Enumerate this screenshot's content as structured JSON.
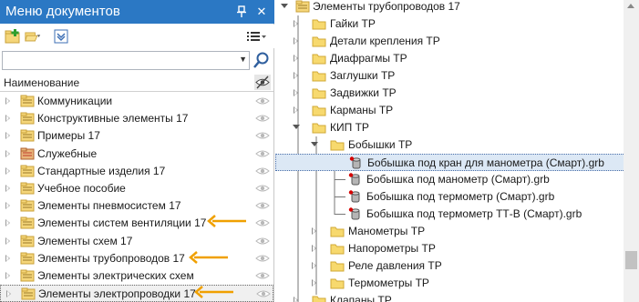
{
  "panel": {
    "title": "Меню документов",
    "pin_glyph": "⊥",
    "close_glyph": "✕",
    "search_placeholder": "",
    "column_header": "Наименование",
    "items": [
      {
        "label": "Коммуникации",
        "icon": "folder-icon"
      },
      {
        "label": "Конструктивные элементы 17",
        "icon": "folder-icon"
      },
      {
        "label": "Примеры 17",
        "icon": "folder-icon"
      },
      {
        "label": "Служебные",
        "icon": "folder-red-icon"
      },
      {
        "label": "Стандартные изделия 17",
        "icon": "folder-icon"
      },
      {
        "label": "Учебное пособие",
        "icon": "folder-icon"
      },
      {
        "label": "Элементы пневмосистем 17",
        "icon": "folder-icon"
      },
      {
        "label": "Элементы систем вентиляции 17",
        "icon": "folder-icon"
      },
      {
        "label": "Элементы схем 17",
        "icon": "folder-icon"
      },
      {
        "label": "Элементы трубопроводов 17",
        "icon": "folder-icon"
      },
      {
        "label": "Элементы электрических схем",
        "icon": "folder-icon"
      },
      {
        "label": "Элементы электропроводки 17",
        "icon": "folder-icon"
      }
    ],
    "highlighted_items": [
      7,
      9,
      11
    ],
    "selected_item": 11
  },
  "tree": {
    "root": "Элементы трубопроводов 17",
    "nodes": [
      {
        "label": "Гайки ТР",
        "level": 1,
        "expand": "collapsed",
        "icon": "folder-icon"
      },
      {
        "label": "Детали крепления ТР",
        "level": 1,
        "expand": "collapsed",
        "icon": "folder-icon"
      },
      {
        "label": "Диафрагмы ТР",
        "level": 1,
        "expand": "collapsed",
        "icon": "folder-icon"
      },
      {
        "label": "Заглушки ТР",
        "level": 1,
        "expand": "collapsed",
        "icon": "folder-icon"
      },
      {
        "label": "Задвижки ТР",
        "level": 1,
        "expand": "collapsed",
        "icon": "folder-icon"
      },
      {
        "label": "Карманы ТР",
        "level": 1,
        "expand": "collapsed",
        "icon": "folder-icon"
      },
      {
        "label": "КИП ТР",
        "level": 1,
        "expand": "expanded",
        "icon": "folder-open-icon"
      },
      {
        "label": "Бобышки ТР",
        "level": 2,
        "expand": "expanded",
        "icon": "folder-open-icon"
      },
      {
        "label": "Бобышка под кран для манометра (Смарт).grb",
        "level": 3,
        "expand": "none",
        "icon": "part-file-icon"
      },
      {
        "label": "Бобышка под манометр (Смарт).grb",
        "level": 3,
        "expand": "none",
        "icon": "part-file-icon"
      },
      {
        "label": "Бобышка под термометр (Смарт).grb",
        "level": 3,
        "expand": "none",
        "icon": "part-file-icon"
      },
      {
        "label": "Бобышка под термометр ТТ-В (Смарт).grb",
        "level": 3,
        "expand": "none",
        "icon": "part-file-icon"
      },
      {
        "label": "Манометры ТР",
        "level": 2,
        "expand": "collapsed",
        "icon": "folder-icon"
      },
      {
        "label": "Напорометры ТР",
        "level": 2,
        "expand": "collapsed",
        "icon": "folder-icon"
      },
      {
        "label": "Реле давления ТР",
        "level": 2,
        "expand": "collapsed",
        "icon": "folder-icon"
      },
      {
        "label": "Термометры ТР",
        "level": 2,
        "expand": "collapsed",
        "icon": "folder-icon"
      },
      {
        "label": "Клапаны ТР",
        "level": 1,
        "expand": "collapsed",
        "icon": "folder-icon"
      }
    ],
    "selected_node": 8
  },
  "colors": {
    "titlebar": "#2b78c4",
    "folder": "#f5d67a",
    "folder_edge": "#c9a13a",
    "annotation_arrow": "#f0a000",
    "selection": "#dce8f5"
  }
}
